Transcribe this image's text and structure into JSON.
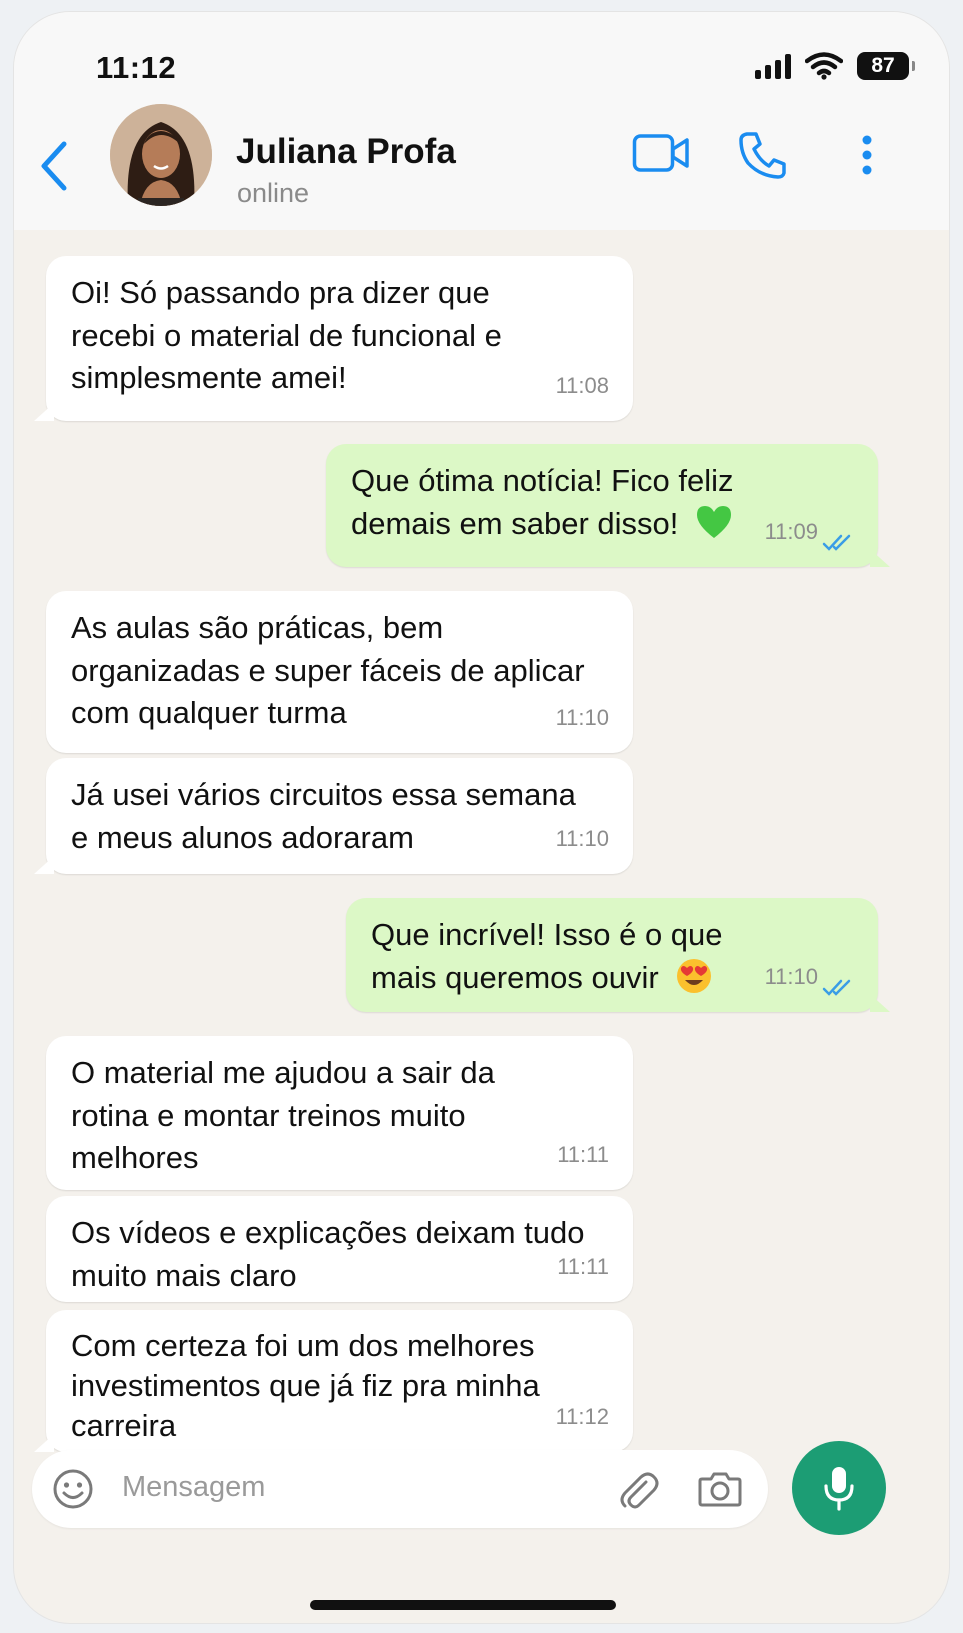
{
  "status_bar": {
    "time": "11:12",
    "battery": "87"
  },
  "header": {
    "name": "Juliana Profa",
    "status": "online",
    "icons": [
      "back-chevron-icon",
      "video-camera-icon",
      "phone-icon",
      "more-vert-icon"
    ],
    "accent_color": "#1a8cf0"
  },
  "messages": [
    {
      "direction": "in",
      "lines": [
        "Oi! Só passando pra dizer que",
        "recebi o material de funcional e",
        "simplesmente amei!"
      ],
      "time": "11:08"
    },
    {
      "direction": "out",
      "lines": [
        "Que ótima notícia! Fico feliz",
        "demais em saber disso!"
      ],
      "emoji": "green-heart-icon",
      "time": "11:09",
      "read": true
    },
    {
      "direction": "in",
      "lines": [
        "As aulas são práticas, bem",
        "organizadas e super fáceis de aplicar",
        "com qualquer turma"
      ],
      "time": "11:10"
    },
    {
      "direction": "in",
      "lines": [
        "Já usei vários circuitos essa semana",
        "e meus alunos adoraram"
      ],
      "time": "11:10"
    },
    {
      "direction": "out",
      "lines": [
        "Que incrível! Isso é o que",
        "mais queremos ouvir"
      ],
      "emoji": "heart-eyes-emoji-icon",
      "time": "11:10",
      "read": true
    },
    {
      "direction": "in",
      "lines": [
        "O material me ajudou a sair da",
        "rotina e montar treinos muito",
        "melhores"
      ],
      "time": "11:11"
    },
    {
      "direction": "in",
      "lines": [
        "Os vídeos e explicações deixam tudo",
        "muito mais claro"
      ],
      "time": "11:11"
    },
    {
      "direction": "in",
      "lines": [
        "Com certeza foi um dos melhores",
        "investimentos que já fiz pra minha",
        "carreira"
      ],
      "time": "11:12"
    }
  ],
  "composer": {
    "placeholder": "Mensagem",
    "icons": [
      "emoji-icon",
      "attach-icon",
      "camera-icon",
      "microphone-icon"
    ]
  },
  "colors": {
    "outgoing_bubble": "#dcf8c6",
    "incoming_bubble": "#ffffff",
    "chat_bg": "#f4f1ec",
    "read_ticks": "#3a9de6",
    "mic_button": "#1c9d74"
  }
}
